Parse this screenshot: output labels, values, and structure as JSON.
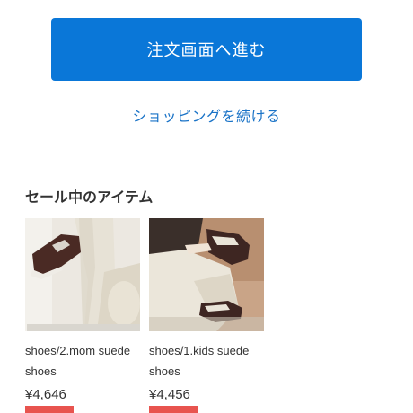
{
  "checkout": {
    "label": "注文画面へ進む"
  },
  "continue": {
    "label": "ショッピングを続ける"
  },
  "sale": {
    "heading": "セール中のアイテム",
    "products": [
      {
        "name": "shoes/2.mom suede shoes",
        "price": "¥4,646"
      },
      {
        "name": "shoes/1.kids suede shoes",
        "price": "¥4,456"
      }
    ]
  },
  "colors": {
    "primary": "#0a77d8",
    "link": "#1a73c7",
    "badge": "#e8544f"
  }
}
